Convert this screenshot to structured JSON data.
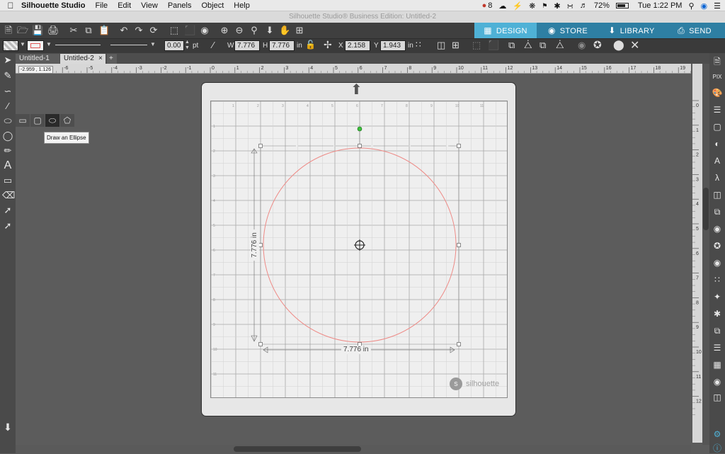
{
  "menubar": {
    "app_name": "Silhouette Studio",
    "menus": [
      "File",
      "Edit",
      "View",
      "Panels",
      "Object",
      "Help"
    ],
    "status": {
      "user_count": "8",
      "battery": "72%",
      "clock": "Tue 1:22 PM"
    }
  },
  "window": {
    "title": "Silhouette Studio® Business Edition: Untitled-2"
  },
  "nav_tabs": {
    "design": "DESIGN",
    "store": "STORE",
    "library": "LIBRARY",
    "send": "SEND"
  },
  "line_settings": {
    "line_width": "0.00",
    "unit": "pt"
  },
  "transform": {
    "w_label": "W",
    "w_value": "7.776",
    "h_label": "H",
    "h_value": "7.776",
    "size_unit": "in",
    "x_label": "X",
    "x_value": "2.158",
    "y_label": "Y",
    "y_value": "1.943",
    "pos_unit": "in"
  },
  "doc_tabs": {
    "tab1": "Untitled-1",
    "tab2": "Untitled-2",
    "close_glyph": "×",
    "add_glyph": "+"
  },
  "cursor_readout": "-2.959 , 1.126",
  "tooltip": "Draw an Ellipse",
  "ruler": {
    "h_ticks": [
      "-7",
      "-6",
      "-5",
      "-4",
      "-3",
      "-2",
      "-1",
      "0",
      "1",
      "2",
      "3",
      "4",
      "5",
      "6",
      "7",
      "8",
      "9",
      "10",
      "11",
      "12",
      "13",
      "14",
      "15",
      "16",
      "17",
      "18",
      "19"
    ],
    "v_ticks": [
      "0",
      "1",
      "2",
      "3",
      "4",
      "5",
      "6",
      "7",
      "8",
      "9",
      "10",
      "11",
      "12"
    ]
  },
  "shape": {
    "width_dim": "7.776 in",
    "height_dim": "7.776 in",
    "stroke_color": "#ee8a86"
  },
  "mat": {
    "brand": "silhouette",
    "inner_x_ticks": [
      "1",
      "2",
      "3",
      "4",
      "5",
      "6",
      "7",
      "8",
      "9",
      "10",
      "11"
    ],
    "inner_y_ticks": [
      "1",
      "2",
      "3",
      "4",
      "5",
      "6",
      "7",
      "8",
      "9",
      "10",
      "11"
    ]
  },
  "colors": {
    "accent_design": "#4fb1d6",
    "nav_blue": "#2e7fa3",
    "selection_handle": "#3cbf3c"
  }
}
